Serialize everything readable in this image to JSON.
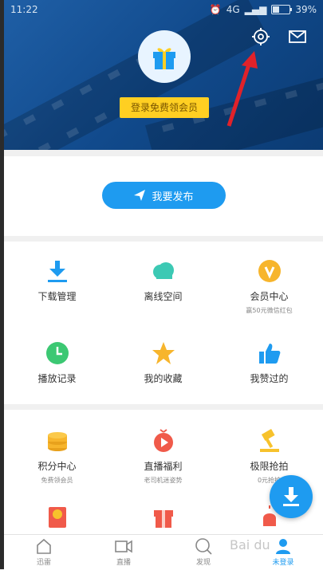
{
  "status_bar": {
    "time": "11:22",
    "network": "4G",
    "battery": "39%",
    "battery_level": 0.39
  },
  "header": {
    "login_label": "登录免费领会员"
  },
  "publish": {
    "label": "我要发布"
  },
  "grid1": [
    {
      "label": "下载管理",
      "sub": "",
      "icon": "download-icon",
      "color": "#1e9bf0"
    },
    {
      "label": "离线空间",
      "sub": "",
      "icon": "cloud-icon",
      "color": "#3cc9b4"
    },
    {
      "label": "会员中心",
      "sub": "赢50元微信红包",
      "icon": "vip-icon",
      "color": "#f7b52c"
    },
    {
      "label": "播放记录",
      "sub": "",
      "icon": "clock-icon",
      "color": "#3cc873"
    },
    {
      "label": "我的收藏",
      "sub": "",
      "icon": "star-icon",
      "color": "#f7b52c"
    },
    {
      "label": "我赞过的",
      "sub": "",
      "icon": "thumb-up-icon",
      "color": "#1e9bf0"
    }
  ],
  "grid2": [
    {
      "label": "积分中心",
      "sub": "免费领会员",
      "icon": "coins-icon",
      "color": "#f7b52c"
    },
    {
      "label": "直播福利",
      "sub": "老司机迷姿势",
      "icon": "live-gift-icon",
      "color": "#f05a4a"
    },
    {
      "label": "极限抢拍",
      "sub": "0元抢拍",
      "icon": "auction-hammer-icon",
      "color": "#f7c22c"
    }
  ],
  "bottom_nav": [
    {
      "label": "迅雷",
      "icon": "home-icon"
    },
    {
      "label": "直播",
      "icon": "video-icon"
    },
    {
      "label": "发现",
      "icon": "discover-icon"
    },
    {
      "label": "未登录",
      "icon": "profile-icon"
    }
  ],
  "watermark": "Bai du"
}
